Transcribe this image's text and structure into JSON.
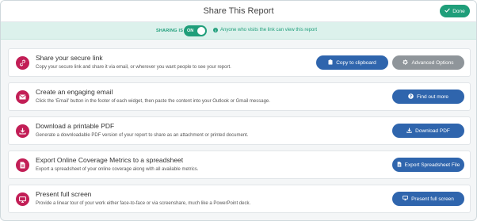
{
  "header": {
    "title": "Share This Report",
    "done_label": "Done"
  },
  "sharing": {
    "label": "SHARING IS",
    "toggle_state": "ON",
    "note": "Anyone who visits the link can view this report"
  },
  "rows": [
    {
      "icon": "link-icon",
      "title": "Share your secure link",
      "description": "Copy your secure link and share it via email, or wherever you want people to see your report.",
      "buttons": [
        {
          "label": "Copy to clipboard",
          "icon": "clipboard-icon"
        },
        {
          "label": "Advanced Options",
          "icon": "gear-icon"
        }
      ]
    },
    {
      "icon": "email-icon",
      "title": "Create an engaging email",
      "description": "Click the ‘Email’ button in the footer of each widget, then paste the content into your Outlook or Gmail message.",
      "buttons": [
        {
          "label": "Find out more",
          "icon": "question-icon"
        }
      ]
    },
    {
      "icon": "download-icon",
      "title": "Download a printable PDF",
      "description": "Generate a downloadable PDF version of your report to share as an attachment or printed document.",
      "buttons": [
        {
          "label": "Download PDF",
          "icon": "download-icon"
        }
      ]
    },
    {
      "icon": "spreadsheet-icon",
      "title": "Export Online Coverage Metrics to a spreadsheet",
      "description": "Export a spreadsheet of your online coverage along with all available metrics.",
      "buttons": [
        {
          "label": "Export Spreadsheet File",
          "icon": "file-icon"
        }
      ]
    },
    {
      "icon": "monitor-icon",
      "title": "Present full screen",
      "description": "Provide a linear tour of your work either face-to-face or via screenshare, much like a PowerPoint deck.",
      "buttons": [
        {
          "label": "Present full screen",
          "icon": "monitor-icon"
        }
      ]
    }
  ],
  "colors": {
    "accent_green": "#1f9e7a",
    "row_icon_bg": "#c21e56",
    "button_blue": "#2f65ad",
    "button_gray": "#8f959a"
  }
}
